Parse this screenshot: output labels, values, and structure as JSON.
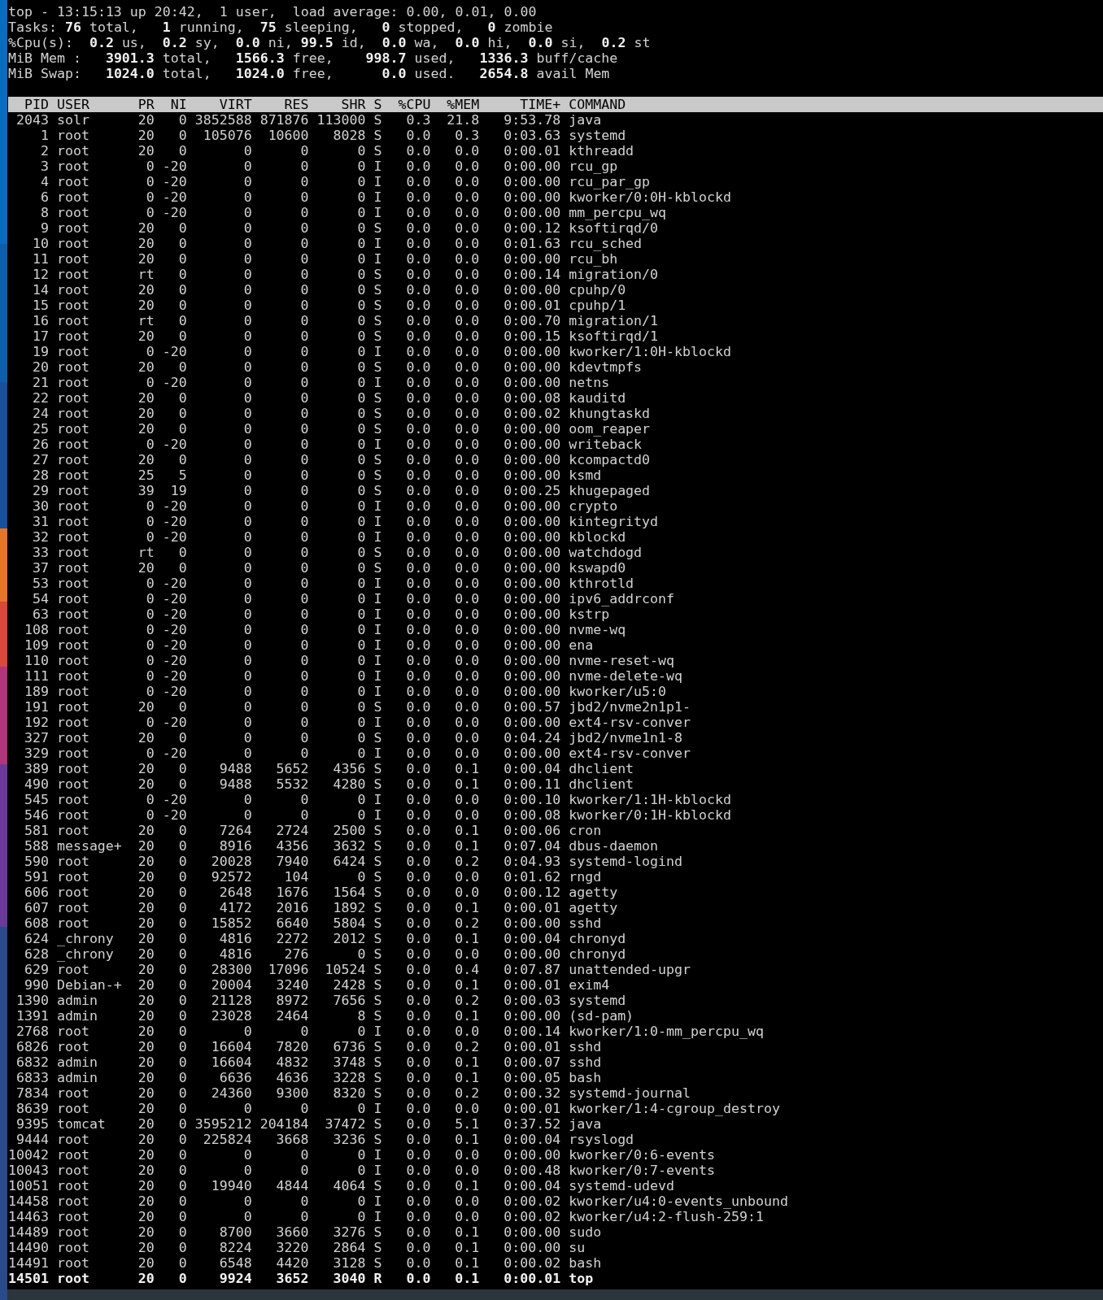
{
  "summary": [
    "top - 13:15:13 up 20:42,  1 user,  load average: 0.00, 0.01, 0.00",
    "Tasks: **76** total,   **1** running,  **75** sleeping,   **0** stopped,   **0** zombie",
    "%Cpu(s):  **0.2** us,  **0.2** sy,  **0.0** ni, **99.5** id,  **0.0** wa,  **0.0** hi,  **0.0** si,  **0.2** st",
    "MiB Mem :   **3901.3** total,   **1566.3** free,    **998.7** used,   **1336.3** buff/cache",
    "MiB Swap:   **1024.0** total,   **1024.0** free,      **0.0** used.   **2654.8** avail Mem"
  ],
  "columns": [
    "PID",
    "USER",
    "PR",
    "NI",
    "VIRT",
    "RES",
    "SHR",
    "S",
    "%CPU",
    "%MEM",
    "TIME+",
    "COMMAND"
  ],
  "rows": [
    {
      "cells": [
        "2043",
        "solr",
        "20",
        "0",
        "3852588",
        "871876",
        "113000",
        "S",
        "0.3",
        "21.8",
        "9:53.78",
        "java"
      ],
      "bold": false
    },
    {
      "cells": [
        "1",
        "root",
        "20",
        "0",
        "105076",
        "10600",
        "8028",
        "S",
        "0.0",
        "0.3",
        "0:03.63",
        "systemd"
      ],
      "bold": false
    },
    {
      "cells": [
        "2",
        "root",
        "20",
        "0",
        "0",
        "0",
        "0",
        "S",
        "0.0",
        "0.0",
        "0:00.01",
        "kthreadd"
      ],
      "bold": false
    },
    {
      "cells": [
        "3",
        "root",
        "0",
        "-20",
        "0",
        "0",
        "0",
        "I",
        "0.0",
        "0.0",
        "0:00.00",
        "rcu_gp"
      ],
      "bold": false
    },
    {
      "cells": [
        "4",
        "root",
        "0",
        "-20",
        "0",
        "0",
        "0",
        "I",
        "0.0",
        "0.0",
        "0:00.00",
        "rcu_par_gp"
      ],
      "bold": false
    },
    {
      "cells": [
        "6",
        "root",
        "0",
        "-20",
        "0",
        "0",
        "0",
        "I",
        "0.0",
        "0.0",
        "0:00.00",
        "kworker/0:0H-kblockd"
      ],
      "bold": false
    },
    {
      "cells": [
        "8",
        "root",
        "0",
        "-20",
        "0",
        "0",
        "0",
        "I",
        "0.0",
        "0.0",
        "0:00.00",
        "mm_percpu_wq"
      ],
      "bold": false
    },
    {
      "cells": [
        "9",
        "root",
        "20",
        "0",
        "0",
        "0",
        "0",
        "S",
        "0.0",
        "0.0",
        "0:00.12",
        "ksoftirqd/0"
      ],
      "bold": false
    },
    {
      "cells": [
        "10",
        "root",
        "20",
        "0",
        "0",
        "0",
        "0",
        "I",
        "0.0",
        "0.0",
        "0:01.63",
        "rcu_sched"
      ],
      "bold": false
    },
    {
      "cells": [
        "11",
        "root",
        "20",
        "0",
        "0",
        "0",
        "0",
        "I",
        "0.0",
        "0.0",
        "0:00.00",
        "rcu_bh"
      ],
      "bold": false
    },
    {
      "cells": [
        "12",
        "root",
        "rt",
        "0",
        "0",
        "0",
        "0",
        "S",
        "0.0",
        "0.0",
        "0:00.14",
        "migration/0"
      ],
      "bold": false
    },
    {
      "cells": [
        "14",
        "root",
        "20",
        "0",
        "0",
        "0",
        "0",
        "S",
        "0.0",
        "0.0",
        "0:00.00",
        "cpuhp/0"
      ],
      "bold": false
    },
    {
      "cells": [
        "15",
        "root",
        "20",
        "0",
        "0",
        "0",
        "0",
        "S",
        "0.0",
        "0.0",
        "0:00.01",
        "cpuhp/1"
      ],
      "bold": false
    },
    {
      "cells": [
        "16",
        "root",
        "rt",
        "0",
        "0",
        "0",
        "0",
        "S",
        "0.0",
        "0.0",
        "0:00.70",
        "migration/1"
      ],
      "bold": false
    },
    {
      "cells": [
        "17",
        "root",
        "20",
        "0",
        "0",
        "0",
        "0",
        "S",
        "0.0",
        "0.0",
        "0:00.15",
        "ksoftirqd/1"
      ],
      "bold": false
    },
    {
      "cells": [
        "19",
        "root",
        "0",
        "-20",
        "0",
        "0",
        "0",
        "I",
        "0.0",
        "0.0",
        "0:00.00",
        "kworker/1:0H-kblockd"
      ],
      "bold": false
    },
    {
      "cells": [
        "20",
        "root",
        "20",
        "0",
        "0",
        "0",
        "0",
        "S",
        "0.0",
        "0.0",
        "0:00.00",
        "kdevtmpfs"
      ],
      "bold": false
    },
    {
      "cells": [
        "21",
        "root",
        "0",
        "-20",
        "0",
        "0",
        "0",
        "I",
        "0.0",
        "0.0",
        "0:00.00",
        "netns"
      ],
      "bold": false
    },
    {
      "cells": [
        "22",
        "root",
        "20",
        "0",
        "0",
        "0",
        "0",
        "S",
        "0.0",
        "0.0",
        "0:00.08",
        "kauditd"
      ],
      "bold": false
    },
    {
      "cells": [
        "24",
        "root",
        "20",
        "0",
        "0",
        "0",
        "0",
        "S",
        "0.0",
        "0.0",
        "0:00.02",
        "khungtaskd"
      ],
      "bold": false
    },
    {
      "cells": [
        "25",
        "root",
        "20",
        "0",
        "0",
        "0",
        "0",
        "S",
        "0.0",
        "0.0",
        "0:00.00",
        "oom_reaper"
      ],
      "bold": false
    },
    {
      "cells": [
        "26",
        "root",
        "0",
        "-20",
        "0",
        "0",
        "0",
        "I",
        "0.0",
        "0.0",
        "0:00.00",
        "writeback"
      ],
      "bold": false
    },
    {
      "cells": [
        "27",
        "root",
        "20",
        "0",
        "0",
        "0",
        "0",
        "S",
        "0.0",
        "0.0",
        "0:00.00",
        "kcompactd0"
      ],
      "bold": false
    },
    {
      "cells": [
        "28",
        "root",
        "25",
        "5",
        "0",
        "0",
        "0",
        "S",
        "0.0",
        "0.0",
        "0:00.00",
        "ksmd"
      ],
      "bold": false
    },
    {
      "cells": [
        "29",
        "root",
        "39",
        "19",
        "0",
        "0",
        "0",
        "S",
        "0.0",
        "0.0",
        "0:00.25",
        "khugepaged"
      ],
      "bold": false
    },
    {
      "cells": [
        "30",
        "root",
        "0",
        "-20",
        "0",
        "0",
        "0",
        "I",
        "0.0",
        "0.0",
        "0:00.00",
        "crypto"
      ],
      "bold": false
    },
    {
      "cells": [
        "31",
        "root",
        "0",
        "-20",
        "0",
        "0",
        "0",
        "I",
        "0.0",
        "0.0",
        "0:00.00",
        "kintegrityd"
      ],
      "bold": false
    },
    {
      "cells": [
        "32",
        "root",
        "0",
        "-20",
        "0",
        "0",
        "0",
        "I",
        "0.0",
        "0.0",
        "0:00.00",
        "kblockd"
      ],
      "bold": false
    },
    {
      "cells": [
        "33",
        "root",
        "rt",
        "0",
        "0",
        "0",
        "0",
        "S",
        "0.0",
        "0.0",
        "0:00.00",
        "watchdogd"
      ],
      "bold": false
    },
    {
      "cells": [
        "37",
        "root",
        "20",
        "0",
        "0",
        "0",
        "0",
        "S",
        "0.0",
        "0.0",
        "0:00.00",
        "kswapd0"
      ],
      "bold": false
    },
    {
      "cells": [
        "53",
        "root",
        "0",
        "-20",
        "0",
        "0",
        "0",
        "I",
        "0.0",
        "0.0",
        "0:00.00",
        "kthrotld"
      ],
      "bold": false
    },
    {
      "cells": [
        "54",
        "root",
        "0",
        "-20",
        "0",
        "0",
        "0",
        "I",
        "0.0",
        "0.0",
        "0:00.00",
        "ipv6_addrconf"
      ],
      "bold": false
    },
    {
      "cells": [
        "63",
        "root",
        "0",
        "-20",
        "0",
        "0",
        "0",
        "I",
        "0.0",
        "0.0",
        "0:00.00",
        "kstrp"
      ],
      "bold": false
    },
    {
      "cells": [
        "108",
        "root",
        "0",
        "-20",
        "0",
        "0",
        "0",
        "I",
        "0.0",
        "0.0",
        "0:00.00",
        "nvme-wq"
      ],
      "bold": false
    },
    {
      "cells": [
        "109",
        "root",
        "0",
        "-20",
        "0",
        "0",
        "0",
        "I",
        "0.0",
        "0.0",
        "0:00.00",
        "ena"
      ],
      "bold": false
    },
    {
      "cells": [
        "110",
        "root",
        "0",
        "-20",
        "0",
        "0",
        "0",
        "I",
        "0.0",
        "0.0",
        "0:00.00",
        "nvme-reset-wq"
      ],
      "bold": false
    },
    {
      "cells": [
        "111",
        "root",
        "0",
        "-20",
        "0",
        "0",
        "0",
        "I",
        "0.0",
        "0.0",
        "0:00.00",
        "nvme-delete-wq"
      ],
      "bold": false
    },
    {
      "cells": [
        "189",
        "root",
        "0",
        "-20",
        "0",
        "0",
        "0",
        "I",
        "0.0",
        "0.0",
        "0:00.00",
        "kworker/u5:0"
      ],
      "bold": false
    },
    {
      "cells": [
        "191",
        "root",
        "20",
        "0",
        "0",
        "0",
        "0",
        "S",
        "0.0",
        "0.0",
        "0:00.57",
        "jbd2/nvme2n1p1-"
      ],
      "bold": false
    },
    {
      "cells": [
        "192",
        "root",
        "0",
        "-20",
        "0",
        "0",
        "0",
        "I",
        "0.0",
        "0.0",
        "0:00.00",
        "ext4-rsv-conver"
      ],
      "bold": false
    },
    {
      "cells": [
        "327",
        "root",
        "20",
        "0",
        "0",
        "0",
        "0",
        "S",
        "0.0",
        "0.0",
        "0:04.24",
        "jbd2/nvme1n1-8"
      ],
      "bold": false
    },
    {
      "cells": [
        "329",
        "root",
        "0",
        "-20",
        "0",
        "0",
        "0",
        "I",
        "0.0",
        "0.0",
        "0:00.00",
        "ext4-rsv-conver"
      ],
      "bold": false
    },
    {
      "cells": [
        "389",
        "root",
        "20",
        "0",
        "9488",
        "5652",
        "4356",
        "S",
        "0.0",
        "0.1",
        "0:00.04",
        "dhclient"
      ],
      "bold": false
    },
    {
      "cells": [
        "490",
        "root",
        "20",
        "0",
        "9488",
        "5532",
        "4280",
        "S",
        "0.0",
        "0.1",
        "0:00.11",
        "dhclient"
      ],
      "bold": false
    },
    {
      "cells": [
        "545",
        "root",
        "0",
        "-20",
        "0",
        "0",
        "0",
        "I",
        "0.0",
        "0.0",
        "0:00.10",
        "kworker/1:1H-kblockd"
      ],
      "bold": false
    },
    {
      "cells": [
        "546",
        "root",
        "0",
        "-20",
        "0",
        "0",
        "0",
        "I",
        "0.0",
        "0.0",
        "0:00.08",
        "kworker/0:1H-kblockd"
      ],
      "bold": false
    },
    {
      "cells": [
        "581",
        "root",
        "20",
        "0",
        "7264",
        "2724",
        "2500",
        "S",
        "0.0",
        "0.1",
        "0:00.06",
        "cron"
      ],
      "bold": false
    },
    {
      "cells": [
        "588",
        "message+",
        "20",
        "0",
        "8916",
        "4356",
        "3632",
        "S",
        "0.0",
        "0.1",
        "0:07.04",
        "dbus-daemon"
      ],
      "bold": false
    },
    {
      "cells": [
        "590",
        "root",
        "20",
        "0",
        "20028",
        "7940",
        "6424",
        "S",
        "0.0",
        "0.2",
        "0:04.93",
        "systemd-logind"
      ],
      "bold": false
    },
    {
      "cells": [
        "591",
        "root",
        "20",
        "0",
        "92572",
        "104",
        "0",
        "S",
        "0.0",
        "0.0",
        "0:01.62",
        "rngd"
      ],
      "bold": false
    },
    {
      "cells": [
        "606",
        "root",
        "20",
        "0",
        "2648",
        "1676",
        "1564",
        "S",
        "0.0",
        "0.0",
        "0:00.12",
        "agetty"
      ],
      "bold": false
    },
    {
      "cells": [
        "607",
        "root",
        "20",
        "0",
        "4172",
        "2016",
        "1892",
        "S",
        "0.0",
        "0.1",
        "0:00.01",
        "agetty"
      ],
      "bold": false
    },
    {
      "cells": [
        "608",
        "root",
        "20",
        "0",
        "15852",
        "6640",
        "5804",
        "S",
        "0.0",
        "0.2",
        "0:00.00",
        "sshd"
      ],
      "bold": false
    },
    {
      "cells": [
        "624",
        "_chrony",
        "20",
        "0",
        "4816",
        "2272",
        "2012",
        "S",
        "0.0",
        "0.1",
        "0:00.04",
        "chronyd"
      ],
      "bold": false
    },
    {
      "cells": [
        "628",
        "_chrony",
        "20",
        "0",
        "4816",
        "276",
        "0",
        "S",
        "0.0",
        "0.0",
        "0:00.00",
        "chronyd"
      ],
      "bold": false
    },
    {
      "cells": [
        "629",
        "root",
        "20",
        "0",
        "28300",
        "17096",
        "10524",
        "S",
        "0.0",
        "0.4",
        "0:07.87",
        "unattended-upgr"
      ],
      "bold": false
    },
    {
      "cells": [
        "990",
        "Debian-+",
        "20",
        "0",
        "20004",
        "3240",
        "2428",
        "S",
        "0.0",
        "0.1",
        "0:00.01",
        "exim4"
      ],
      "bold": false
    },
    {
      "cells": [
        "1390",
        "admin",
        "20",
        "0",
        "21128",
        "8972",
        "7656",
        "S",
        "0.0",
        "0.2",
        "0:00.03",
        "systemd"
      ],
      "bold": false
    },
    {
      "cells": [
        "1391",
        "admin",
        "20",
        "0",
        "23028",
        "2464",
        "8",
        "S",
        "0.0",
        "0.1",
        "0:00.00",
        "(sd-pam)"
      ],
      "bold": false
    },
    {
      "cells": [
        "2768",
        "root",
        "20",
        "0",
        "0",
        "0",
        "0",
        "I",
        "0.0",
        "0.0",
        "0:00.14",
        "kworker/1:0-mm_percpu_wq"
      ],
      "bold": false
    },
    {
      "cells": [
        "6826",
        "root",
        "20",
        "0",
        "16604",
        "7820",
        "6736",
        "S",
        "0.0",
        "0.2",
        "0:00.01",
        "sshd"
      ],
      "bold": false
    },
    {
      "cells": [
        "6832",
        "admin",
        "20",
        "0",
        "16604",
        "4832",
        "3748",
        "S",
        "0.0",
        "0.1",
        "0:00.07",
        "sshd"
      ],
      "bold": false
    },
    {
      "cells": [
        "6833",
        "admin",
        "20",
        "0",
        "6636",
        "4636",
        "3228",
        "S",
        "0.0",
        "0.1",
        "0:00.05",
        "bash"
      ],
      "bold": false
    },
    {
      "cells": [
        "7834",
        "root",
        "20",
        "0",
        "24360",
        "9300",
        "8320",
        "S",
        "0.0",
        "0.2",
        "0:00.32",
        "systemd-journal"
      ],
      "bold": false
    },
    {
      "cells": [
        "8639",
        "root",
        "20",
        "0",
        "0",
        "0",
        "0",
        "I",
        "0.0",
        "0.0",
        "0:00.01",
        "kworker/1:4-cgroup_destroy"
      ],
      "bold": false
    },
    {
      "cells": [
        "9395",
        "tomcat",
        "20",
        "0",
        "3595212",
        "204184",
        "37472",
        "S",
        "0.0",
        "5.1",
        "0:37.52",
        "java"
      ],
      "bold": false
    },
    {
      "cells": [
        "9444",
        "root",
        "20",
        "0",
        "225824",
        "3668",
        "3236",
        "S",
        "0.0",
        "0.1",
        "0:00.04",
        "rsyslogd"
      ],
      "bold": false
    },
    {
      "cells": [
        "10042",
        "root",
        "20",
        "0",
        "0",
        "0",
        "0",
        "I",
        "0.0",
        "0.0",
        "0:00.00",
        "kworker/0:6-events"
      ],
      "bold": false
    },
    {
      "cells": [
        "10043",
        "root",
        "20",
        "0",
        "0",
        "0",
        "0",
        "I",
        "0.0",
        "0.0",
        "0:00.48",
        "kworker/0:7-events"
      ],
      "bold": false
    },
    {
      "cells": [
        "10051",
        "root",
        "20",
        "0",
        "19940",
        "4844",
        "4064",
        "S",
        "0.0",
        "0.1",
        "0:00.04",
        "systemd-udevd"
      ],
      "bold": false
    },
    {
      "cells": [
        "14458",
        "root",
        "20",
        "0",
        "0",
        "0",
        "0",
        "I",
        "0.0",
        "0.0",
        "0:00.02",
        "kworker/u4:0-events_unbound"
      ],
      "bold": false
    },
    {
      "cells": [
        "14463",
        "root",
        "20",
        "0",
        "0",
        "0",
        "0",
        "I",
        "0.0",
        "0.0",
        "0:00.02",
        "kworker/u4:2-flush-259:1"
      ],
      "bold": false
    },
    {
      "cells": [
        "14489",
        "root",
        "20",
        "0",
        "8700",
        "3660",
        "3276",
        "S",
        "0.0",
        "0.1",
        "0:00.00",
        "sudo"
      ],
      "bold": false
    },
    {
      "cells": [
        "14490",
        "root",
        "20",
        "0",
        "8224",
        "3220",
        "2864",
        "S",
        "0.0",
        "0.1",
        "0:00.00",
        "su"
      ],
      "bold": false
    },
    {
      "cells": [
        "14491",
        "root",
        "20",
        "0",
        "6548",
        "4420",
        "3128",
        "S",
        "0.0",
        "0.1",
        "0:00.02",
        "bash"
      ],
      "bold": false
    },
    {
      "cells": [
        "14501",
        "root",
        "20",
        "0",
        "9924",
        "3652",
        "3040",
        "R",
        "0.0",
        "0.1",
        "0:00.01",
        "top"
      ],
      "bold": true
    }
  ]
}
